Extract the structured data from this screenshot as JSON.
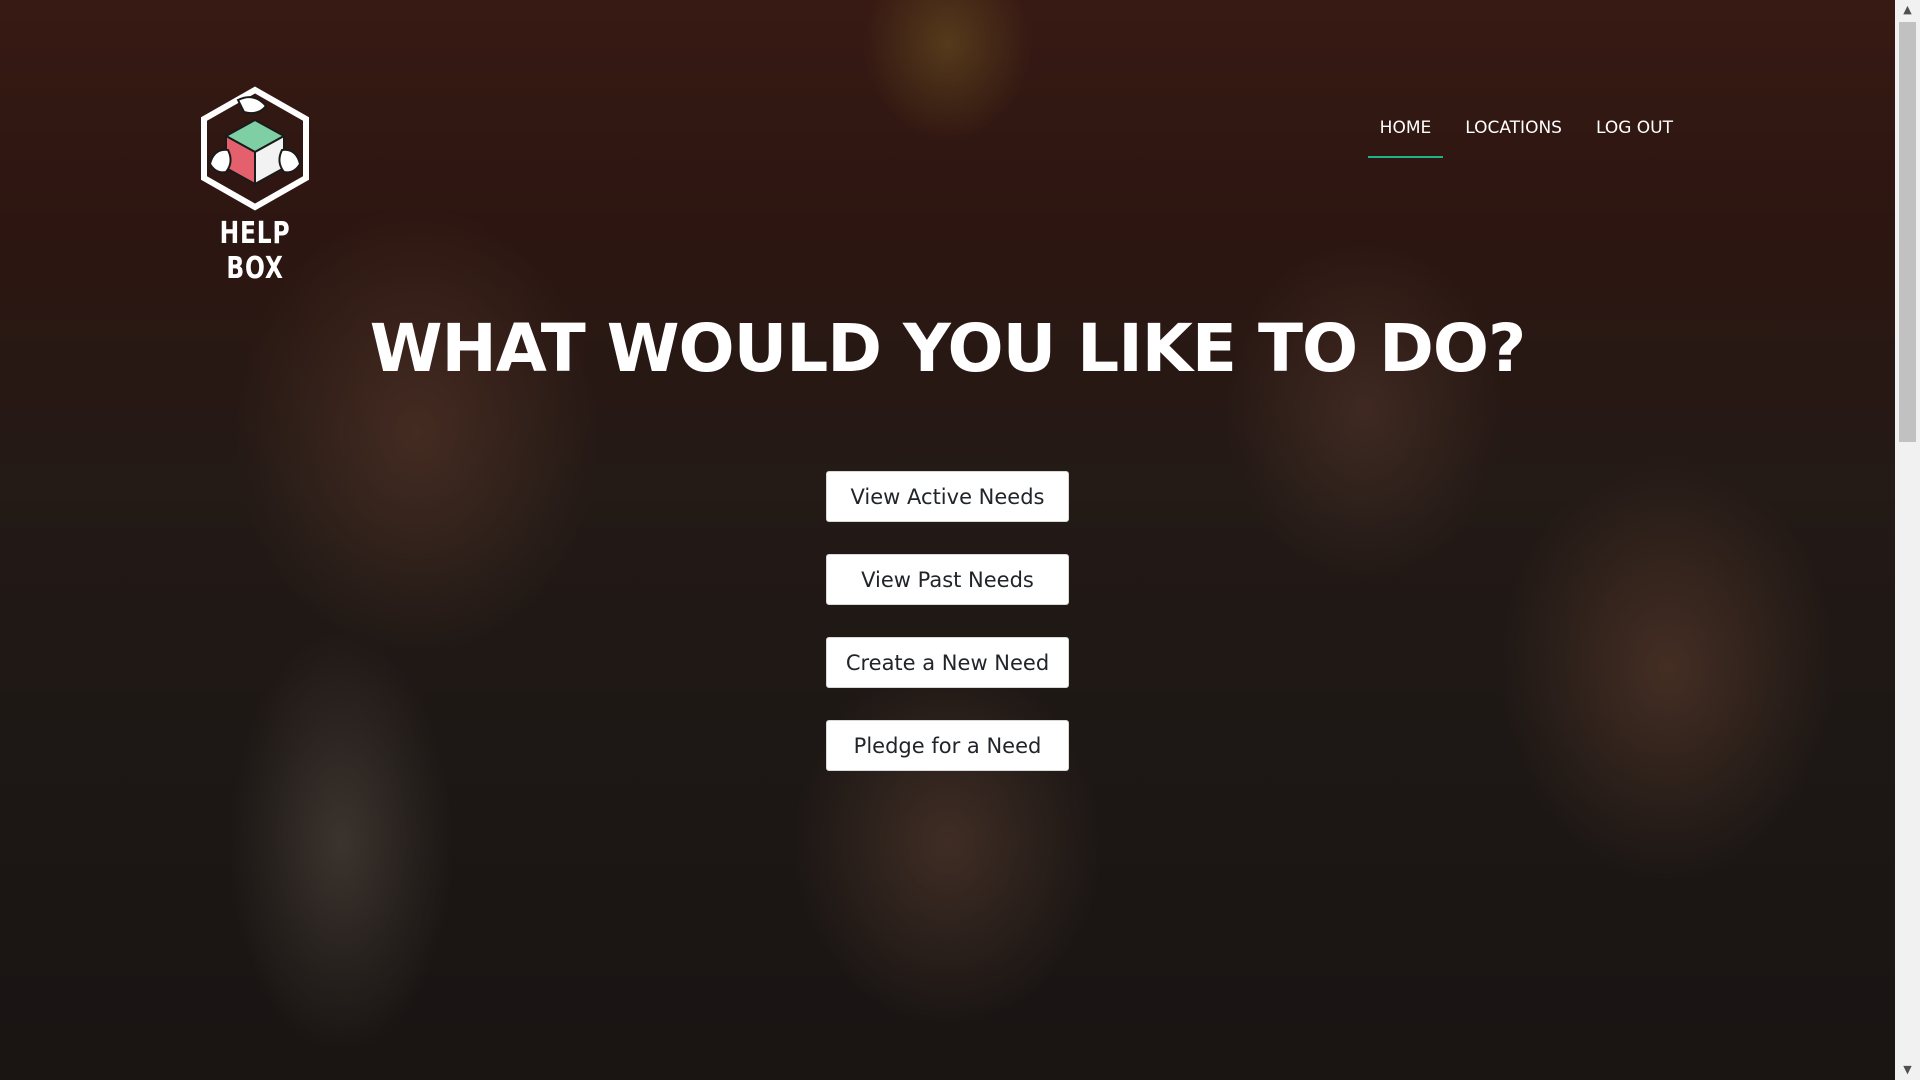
{
  "brand": {
    "name": "HELP BOX",
    "logo_icon": "helping-hands-box-icon",
    "colors": {
      "box_green": "#7fcfa4",
      "box_red": "#e4606d",
      "outline": "#ffffff"
    }
  },
  "nav": {
    "items": [
      {
        "label": "HOME",
        "active": true
      },
      {
        "label": "LOCATIONS",
        "active": false
      },
      {
        "label": "LOG OUT",
        "active": false
      }
    ],
    "active_underline_color": "#1fb38a"
  },
  "hero": {
    "headline": "WHAT WOULD YOU LIKE TO DO?",
    "background": "photo-of-smiling-children"
  },
  "actions": [
    {
      "label": "View Active Needs"
    },
    {
      "label": "View Past Needs"
    },
    {
      "label": "Create a New Need"
    },
    {
      "label": "Pledge for a Need"
    }
  ],
  "scrollbar": {
    "up_icon": "▲",
    "down_icon": "▼"
  }
}
